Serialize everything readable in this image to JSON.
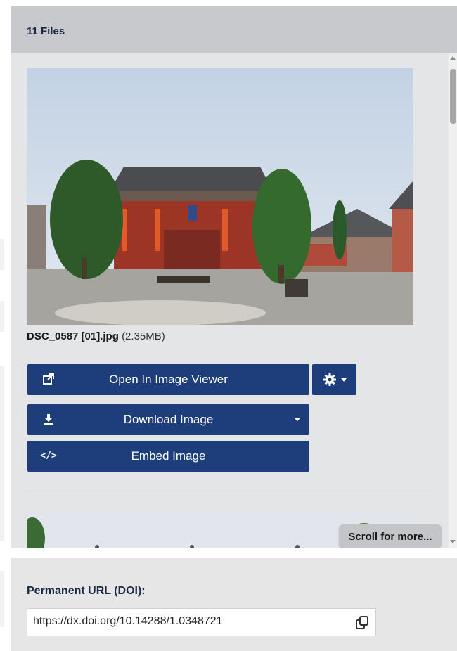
{
  "panel": {
    "title": "11 Files"
  },
  "file": {
    "name": "DSC_0587 [01].jpg",
    "size": "(2.35MB)"
  },
  "buttons": {
    "open_viewer": "Open In Image Viewer",
    "download": "Download Image",
    "embed": "Embed Image"
  },
  "icons": {
    "open_viewer": "external-link-icon",
    "settings": "gear-icon",
    "download": "download-icon",
    "embed": "code-icon"
  },
  "scroll_hint": "Scroll for more...",
  "doi": {
    "label": "Permanent URL (DOI):",
    "value": "https://dx.doi.org/10.14288/1.0348721"
  },
  "colors": {
    "button": "#1e3d7b",
    "header": "#c8c9cc",
    "panel": "#e6e6e6"
  }
}
